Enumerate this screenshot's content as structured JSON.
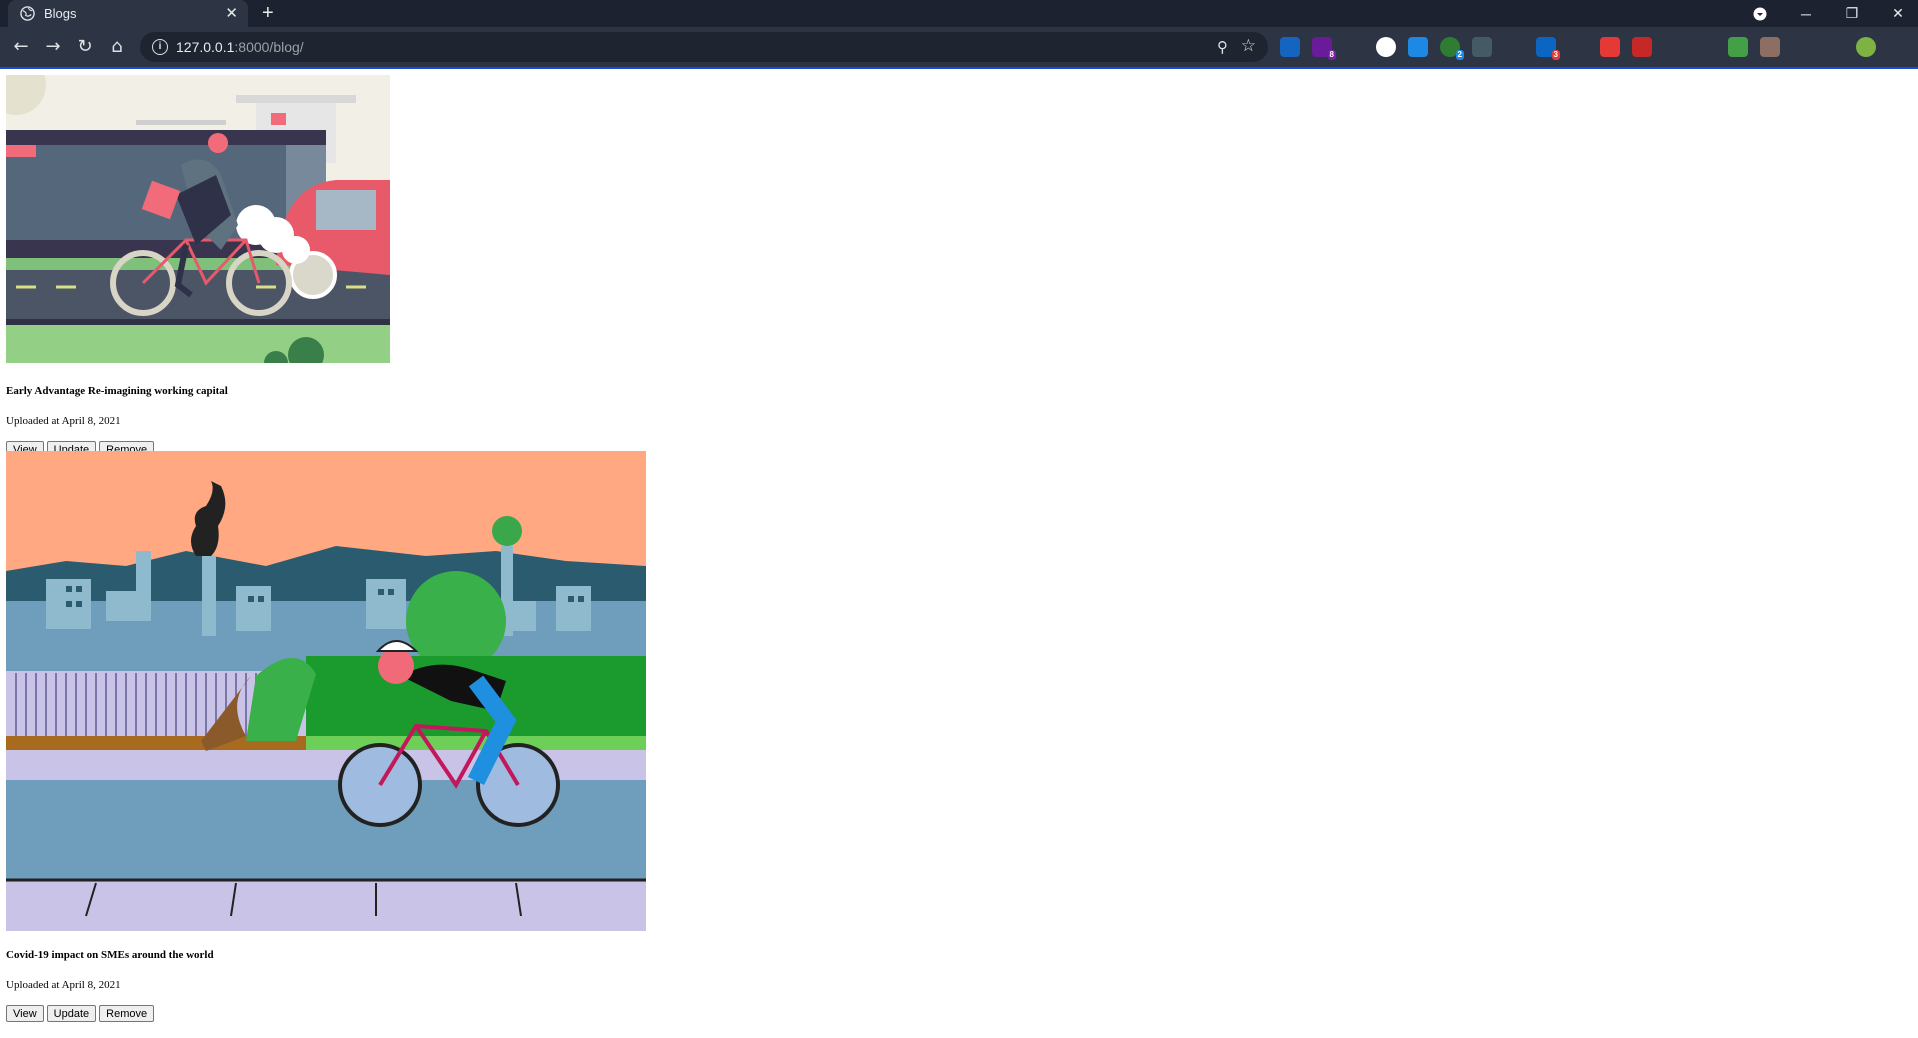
{
  "browser": {
    "tab_title": "Blogs",
    "url_host": "127.0.0.1",
    "url_path": ":8000/blog/",
    "extensions": [
      {
        "icon": "s-icon",
        "color": "#1565c0",
        "badge": ""
      },
      {
        "icon": "puzzle-badge-icon",
        "color": "#6a1b9a",
        "badge": "8"
      },
      {
        "icon": "atom-icon",
        "color": "#2d3444",
        "badge": ""
      },
      {
        "icon": "circle-face-icon",
        "color": "#ffffff",
        "badge": ""
      },
      {
        "icon": "s-square-icon",
        "color": "#1e88e5",
        "badge": ""
      },
      {
        "icon": "green-dot-icon",
        "color": "#2e7d32",
        "badge": "2"
      },
      {
        "icon": "recycle-icon",
        "color": "#455a64",
        "badge": ""
      },
      {
        "icon": "columns-icon",
        "color": "#2d3444",
        "badge": ""
      },
      {
        "icon": "linkedin-icon",
        "color": "#0a66c2",
        "badge": "3"
      },
      {
        "icon": "window-icon",
        "color": "#2d3444",
        "badge": ""
      },
      {
        "icon": "tp-icon",
        "color": "#e53935",
        "badge": ""
      },
      {
        "icon": "abp-icon",
        "color": "#c62828",
        "badge": ""
      },
      {
        "icon": "cursor-icon",
        "color": "#2d3444",
        "badge": ""
      },
      {
        "icon": "globe-icon",
        "color": "#2d3444",
        "badge": ""
      },
      {
        "icon": "u-icon",
        "color": "#43a047",
        "badge": ""
      },
      {
        "icon": "glasses-icon",
        "color": "#8d6e63",
        "badge": ""
      },
      {
        "icon": "v-icon",
        "color": "#2d3444",
        "badge": ""
      },
      {
        "icon": "puzzle-icon",
        "color": "#2d3444",
        "badge": ""
      },
      {
        "icon": "profile-avatar-icon",
        "color": "#7cb342",
        "badge": ""
      }
    ]
  },
  "posts": [
    {
      "title": "Early Advantage Re-imagining working capital",
      "uploaded": "Uploaded at April 8, 2021",
      "view_label": "View",
      "update_label": "Update",
      "remove_label": "Remove"
    },
    {
      "title": "Covid-19 impact on SMEs around the world",
      "uploaded": "Uploaded at April 8, 2021",
      "view_label": "View",
      "update_label": "Update",
      "remove_label": "Remove"
    }
  ]
}
